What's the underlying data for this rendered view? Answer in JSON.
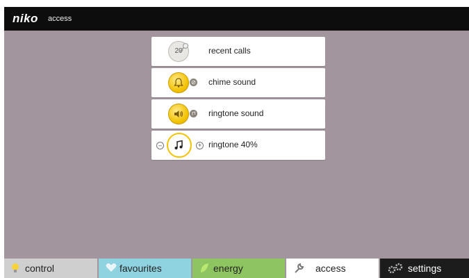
{
  "header": {
    "logo": "niko",
    "section": "access"
  },
  "menu": {
    "recent_calls": {
      "badge": "20",
      "label": "recent calls"
    },
    "chime": {
      "label": "chime sound"
    },
    "ringtone": {
      "label": "ringtone sound"
    },
    "volume": {
      "label": "ringtone 40%",
      "value_percent": 40
    }
  },
  "tabs": [
    {
      "label": "control",
      "color": "#cfcfcf",
      "icon": "lightbulb-icon"
    },
    {
      "label": "favourites",
      "color": "#8fd3e0",
      "icon": "heart-icon"
    },
    {
      "label": "energy",
      "color": "#8fc560",
      "icon": "leaf-icon"
    },
    {
      "label": "access",
      "color": "#ffffff",
      "icon": "wrench-icon"
    },
    {
      "label": "settings",
      "color": "#1c1c1c",
      "icon": "gears-icon"
    }
  ],
  "colors": {
    "background": "#a3959e",
    "accent": "#f2c200"
  }
}
